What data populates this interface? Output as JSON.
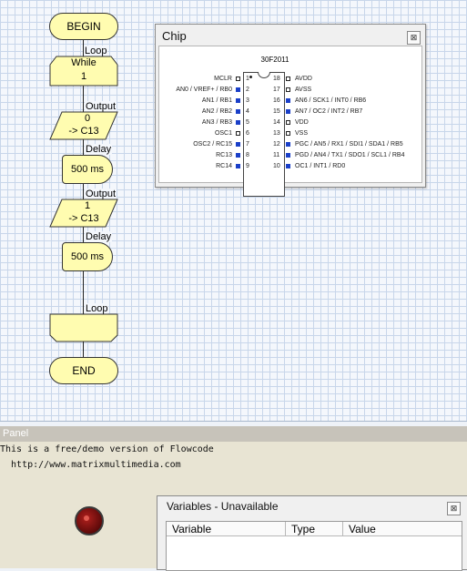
{
  "flowchart": {
    "begin_label": "BEGIN",
    "loop_top": {
      "caption": "Loop",
      "text_line1": "While",
      "text_line2": "1"
    },
    "output1": {
      "caption": "Output",
      "value": "0",
      "target": "-> C13"
    },
    "delay1": {
      "caption": "Delay",
      "value": "500 ms"
    },
    "output2": {
      "caption": "Output",
      "value": "1",
      "target": "-> C13"
    },
    "delay2": {
      "caption": "Delay",
      "value": "500 ms"
    },
    "loop_bottom": {
      "caption": "Loop"
    },
    "end_label": "END"
  },
  "chip_window": {
    "title": "Chip",
    "close_icon": "close-x-icon",
    "chip_name": "30F2011",
    "pins_left": [
      {
        "num": "1",
        "label": "MCLR",
        "active": false
      },
      {
        "num": "2",
        "label": "AN0 / VREF+ / RB0",
        "active": true
      },
      {
        "num": "3",
        "label": "AN1 / RB1",
        "active": true
      },
      {
        "num": "4",
        "label": "AN2 / RB2",
        "active": true
      },
      {
        "num": "5",
        "label": "AN3 / RB3",
        "active": true
      },
      {
        "num": "6",
        "label": "OSC1",
        "active": false
      },
      {
        "num": "7",
        "label": "OSC2 / RC15",
        "active": true
      },
      {
        "num": "8",
        "label": "RC13",
        "active": true
      },
      {
        "num": "9",
        "label": "RC14",
        "active": true
      }
    ],
    "pins_right": [
      {
        "num": "18",
        "label": "AVDD",
        "active": false
      },
      {
        "num": "17",
        "label": "AVSS",
        "active": false
      },
      {
        "num": "16",
        "label": "AN6 / SCK1 / INT0 / RB6",
        "active": true
      },
      {
        "num": "15",
        "label": "AN7 / OC2 / INT2 / RB7",
        "active": true
      },
      {
        "num": "14",
        "label": "VDD",
        "active": false
      },
      {
        "num": "13",
        "label": "VSS",
        "active": false
      },
      {
        "num": "12",
        "label": "PGC / AN5 / RX1 / SDI1 / SDA1 / RB5",
        "active": true
      },
      {
        "num": "11",
        "label": "PGD / AN4 / TX1 / SDO1 / SCL1 / RB4",
        "active": true
      },
      {
        "num": "10",
        "label": "OC1 / INT1 / RD0",
        "active": true
      }
    ],
    "pin_active_color": "#1a3fc8"
  },
  "panel": {
    "title": "Panel",
    "notice_line1": "This is a free/demo version of Flowcode",
    "notice_line2": "  http://www.matrixmultimedia.com",
    "led_color": "#8b1512"
  },
  "variables_window": {
    "title": "Variables - Unavailable",
    "close_icon": "close-x-icon",
    "columns": [
      "Variable",
      "Type",
      "Value"
    ]
  }
}
